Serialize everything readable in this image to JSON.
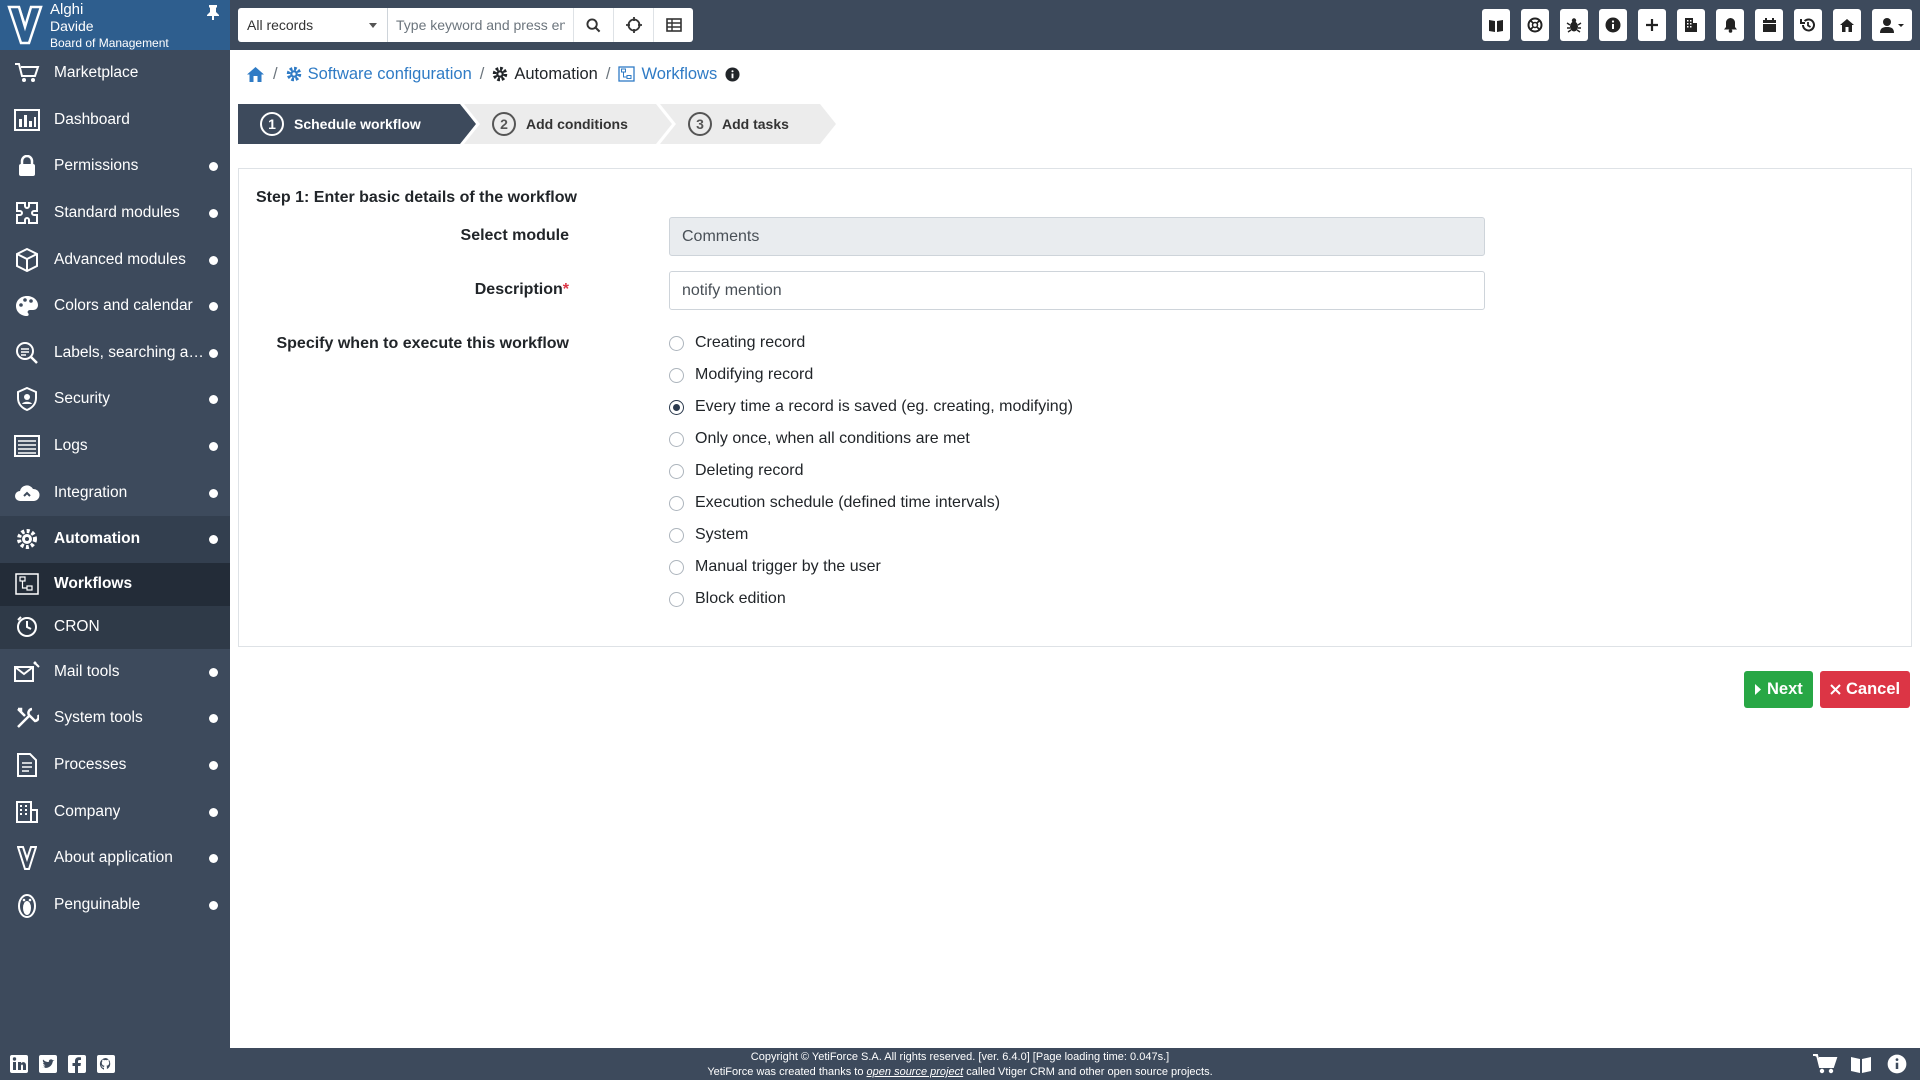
{
  "user": {
    "company": "Alghi",
    "name": "Davide",
    "role": "Board of Management"
  },
  "sidebar": {
    "items": [
      {
        "label": "Marketplace",
        "icon": "cart-icon",
        "expandable": false
      },
      {
        "label": "Dashboard",
        "icon": "dashboard-icon",
        "expandable": false
      },
      {
        "label": "Permissions",
        "icon": "lock-icon",
        "expandable": true
      },
      {
        "label": "Standard modules",
        "icon": "puzzle-icon",
        "expandable": true
      },
      {
        "label": "Advanced modules",
        "icon": "cube-icon",
        "expandable": true
      },
      {
        "label": "Colors and calendar",
        "icon": "palette-icon",
        "expandable": true
      },
      {
        "label": "Labels, searching and filtering",
        "icon": "search-list-icon",
        "expandable": true
      },
      {
        "label": "Security",
        "icon": "shield-icon",
        "expandable": true
      },
      {
        "label": "Logs",
        "icon": "logs-icon",
        "expandable": true
      },
      {
        "label": "Integration",
        "icon": "cloud-icon",
        "expandable": true
      }
    ],
    "active": {
      "label": "Automation",
      "icon": "gears-icon"
    },
    "subitems": [
      {
        "label": "Workflows",
        "icon": "workflow-icon",
        "current": true
      },
      {
        "label": "CRON",
        "icon": "clock-icon",
        "current": false
      }
    ],
    "items_after": [
      {
        "label": "Mail tools",
        "icon": "mail-tools-icon"
      },
      {
        "label": "System tools",
        "icon": "tools-icon"
      },
      {
        "label": "Processes",
        "icon": "processes-icon"
      },
      {
        "label": "Company",
        "icon": "company-icon"
      },
      {
        "label": "About application",
        "icon": "yeti-logo-icon"
      },
      {
        "label": "Penguinable",
        "icon": "penguin-icon"
      }
    ]
  },
  "topbar": {
    "records_select": "All records",
    "search_placeholder": "Type keyword and press enter",
    "right_icons": [
      "book-icon",
      "support-icon",
      "bug-icon",
      "info-icon",
      "plus-icon",
      "building-icon",
      "bell-icon",
      "calendar-icon",
      "history-icon",
      "home-icon",
      "user-icon"
    ]
  },
  "breadcrumb": {
    "home_icon": "home-icon",
    "items": [
      "Software configuration",
      "Automation",
      "Workflows"
    ]
  },
  "wizard": {
    "steps": [
      {
        "num": "1",
        "label": "Schedule workflow",
        "active": true
      },
      {
        "num": "2",
        "label": "Add conditions",
        "active": false
      },
      {
        "num": "3",
        "label": "Add tasks",
        "active": false
      }
    ]
  },
  "form": {
    "title": "Step 1: Enter basic details of the workflow",
    "module_label": "Select module",
    "module_value": "Comments",
    "description_label": "Description",
    "required_mark": "*",
    "description_value": "notify mention",
    "execute_label": "Specify when to execute this workflow",
    "options": [
      {
        "label": "Creating record",
        "checked": false
      },
      {
        "label": "Modifying record",
        "checked": false
      },
      {
        "label": "Every time a record is saved (eg. creating, modifying)",
        "checked": true
      },
      {
        "label": "Only once, when all conditions are met",
        "checked": false
      },
      {
        "label": "Deleting record",
        "checked": false
      },
      {
        "label": "Execution schedule (defined time intervals)",
        "checked": false
      },
      {
        "label": "System",
        "checked": false
      },
      {
        "label": "Manual trigger by the user",
        "checked": false
      },
      {
        "label": "Block edition",
        "checked": false
      }
    ]
  },
  "buttons": {
    "next": "Next",
    "cancel": "Cancel"
  },
  "footer": {
    "line1": "Copyright © YetiForce S.A. All rights reserved. [ver. 6.4.0] [Page loading time: 0.047s.]",
    "line2_pre": "YetiForce was created thanks to ",
    "line2_link": "open source project",
    "line2_post": " called Vtiger CRM and other open source projects.",
    "social": [
      "linkedin-icon",
      "twitter-icon",
      "facebook-icon",
      "github-icon"
    ],
    "right_icons": [
      "cart-icon",
      "book-icon",
      "info-icon"
    ]
  },
  "colors": {
    "sidebar": "#3d4a5c",
    "brand": "#2e5e8e",
    "link": "#2f7bc5",
    "next": "#28a745",
    "cancel": "#dc3545"
  }
}
